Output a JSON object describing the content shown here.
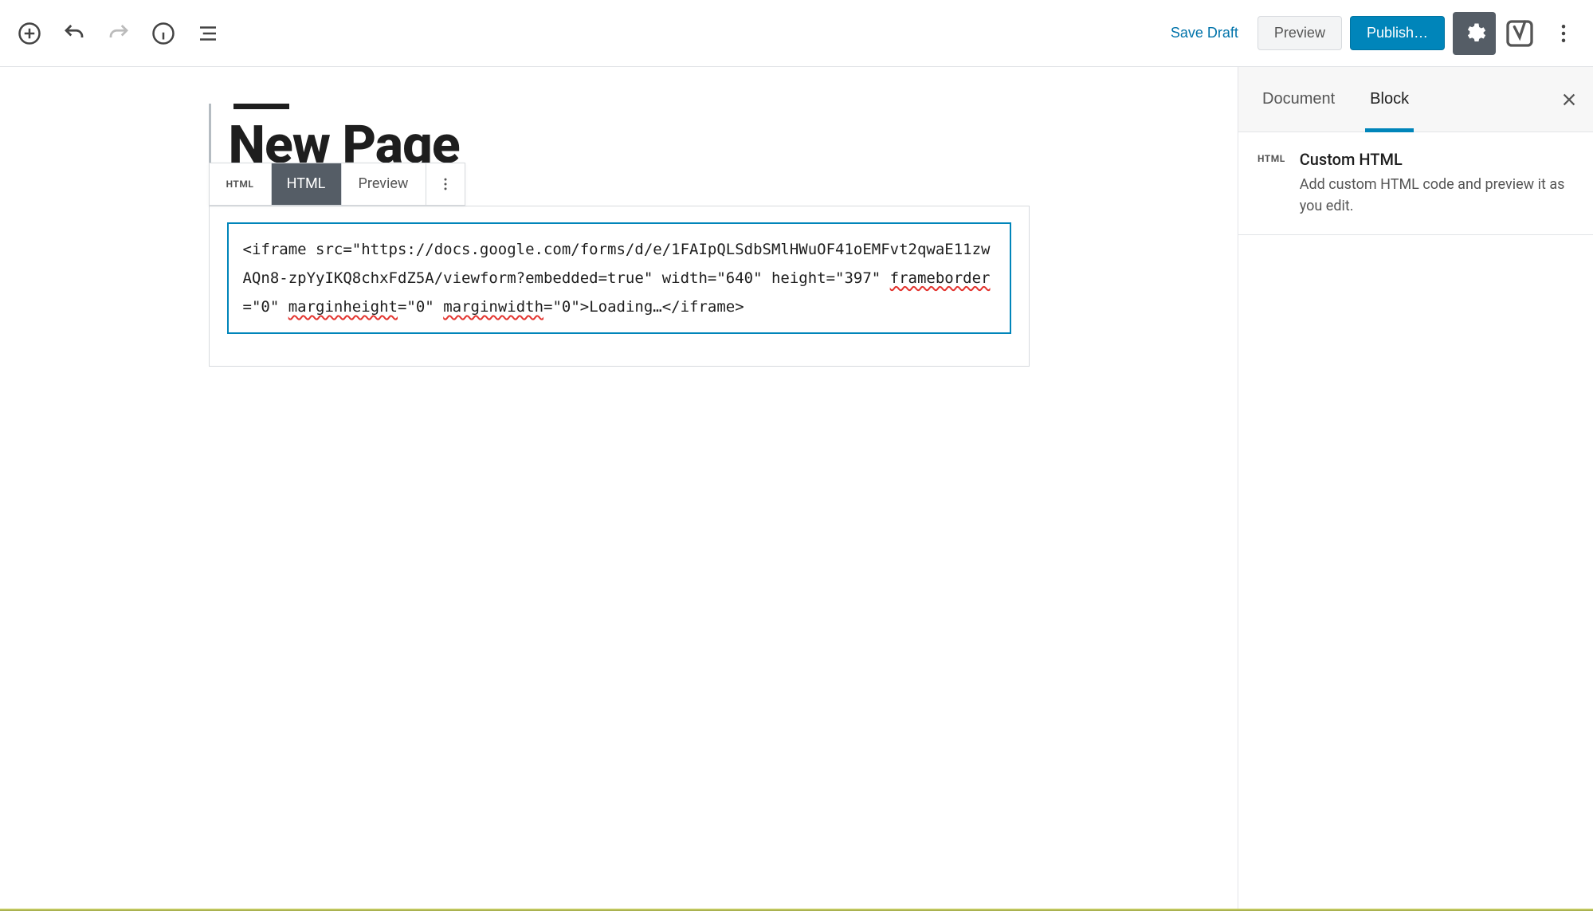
{
  "toolbar": {
    "save_draft": "Save Draft",
    "preview": "Preview",
    "publish": "Publish…"
  },
  "sidebar": {
    "tabs": {
      "document": "Document",
      "block": "Block"
    },
    "block_icon_text": "HTML",
    "block_title": "Custom HTML",
    "block_desc": "Add custom HTML code and preview it as you edit."
  },
  "editor": {
    "page_title": "New Page",
    "block_toolbar": {
      "icon_text": "HTML",
      "html_label": "HTML",
      "preview_label": "Preview"
    },
    "code_parts": {
      "p1": "<iframe src=\"https://docs.google.com/forms/d/e/1FAIpQLSdbSMlHWuOF41oEMFvt2qwaE11zwAQn8-zpYyIKQ8chxFdZ5A/viewform?embedded=true\" width=\"640\" height=\"397\" ",
      "s1": "frameborder",
      "p2": "=\"0\" ",
      "s2": "marginheight",
      "p3": "=\"0\" ",
      "s3": "marginwidth",
      "p4": "=\"0\">Loading…</iframe>"
    }
  }
}
